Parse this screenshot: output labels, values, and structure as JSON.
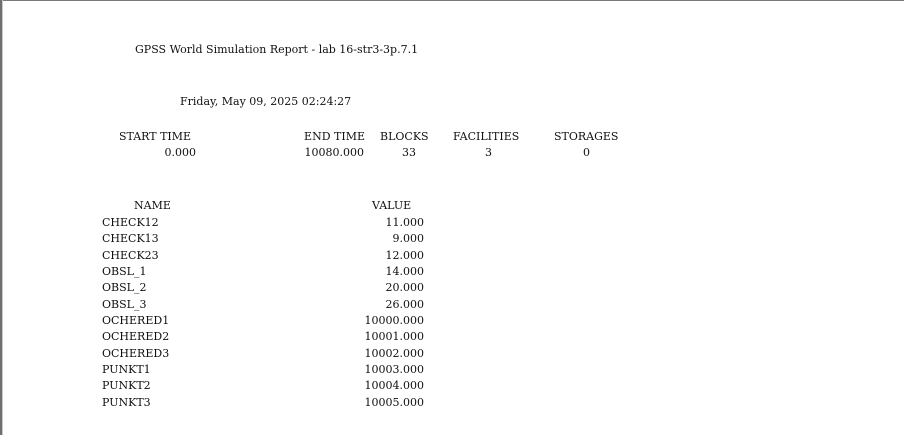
{
  "report": {
    "title": "GPSS World Simulation Report - lab 16-str3-3p.7.1",
    "datetime": "Friday, May 09, 2025 02:24:27",
    "summary": {
      "headers": [
        "START TIME",
        "END TIME",
        "BLOCKS",
        "FACILITIES",
        "STORAGES"
      ],
      "values": [
        "0.000",
        "10080.000",
        "33",
        "3",
        "0"
      ]
    },
    "names_table": {
      "headers": [
        "NAME",
        "VALUE"
      ],
      "rows": [
        {
          "name": "CHECK12",
          "value": "11.000"
        },
        {
          "name": "CHECK13",
          "value": "9.000"
        },
        {
          "name": "CHECK23",
          "value": "12.000"
        },
        {
          "name": "OBSL_1",
          "value": "14.000"
        },
        {
          "name": "OBSL_2",
          "value": "20.000"
        },
        {
          "name": "OBSL_3",
          "value": "26.000"
        },
        {
          "name": "OCHERED1",
          "value": "10000.000"
        },
        {
          "name": "OCHERED2",
          "value": "10001.000"
        },
        {
          "name": "OCHERED3",
          "value": "10002.000"
        },
        {
          "name": "PUNKT1",
          "value": "10003.000"
        },
        {
          "name": "PUNKT2",
          "value": "10004.000"
        },
        {
          "name": "PUNKT3",
          "value": "10005.000"
        }
      ]
    }
  }
}
